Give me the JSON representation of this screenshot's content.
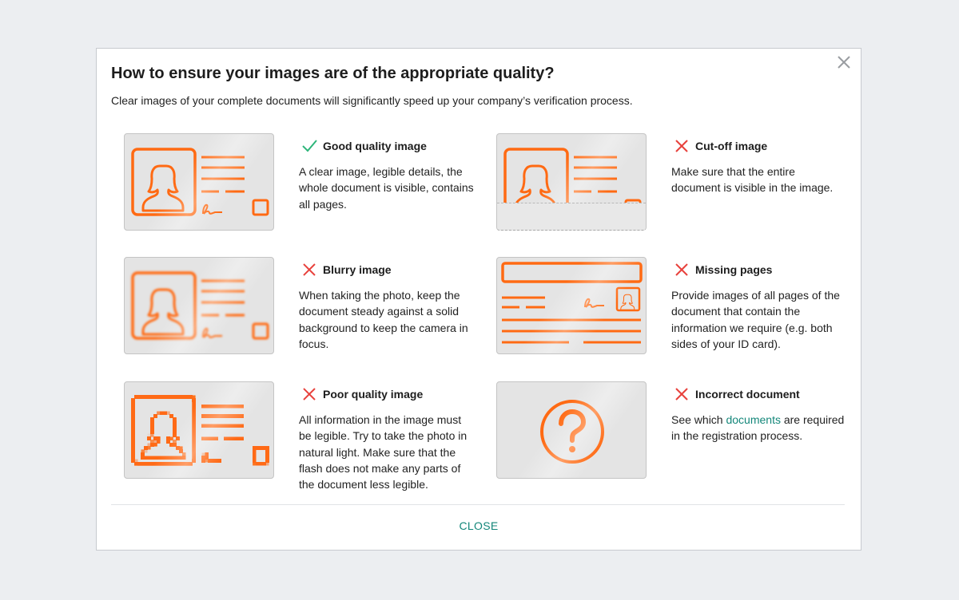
{
  "dialog": {
    "title": "How to ensure your images are of the appropriate quality?",
    "subtitle": "Clear images of your complete documents will significantly speed up your company’s verification process.",
    "close_label": "CLOSE"
  },
  "colors": {
    "accent": "#ff6a13",
    "good": "#2db57a",
    "bad": "#e8413c",
    "link": "#14877a"
  },
  "items": [
    {
      "status_icon": "check-icon",
      "title": "Good quality image",
      "description": "A clear image, legible details, the whole document is visible, contains all pages."
    },
    {
      "status_icon": "cross-icon",
      "title": "Cut-off image",
      "description": "Make sure that the entire document is visible in the image."
    },
    {
      "status_icon": "cross-icon",
      "title": "Blurry image",
      "description": "When taking the photo, keep the document steady against a solid background to keep the camera in focus."
    },
    {
      "status_icon": "cross-icon",
      "title": "Missing pages",
      "description": "Provide images of all pages of the document that contain the information we require (e.g. both sides of your ID card)."
    },
    {
      "status_icon": "cross-icon",
      "title": "Poor quality image",
      "description": "All information in the image must be legible. Try to take the photo in natural light. Make sure that the flash does not make any parts of the document less legible."
    },
    {
      "status_icon": "cross-icon",
      "title": "Incorrect document",
      "description_before": "See which ",
      "description_link": "documents",
      "description_after": " are required in the registration process."
    }
  ]
}
